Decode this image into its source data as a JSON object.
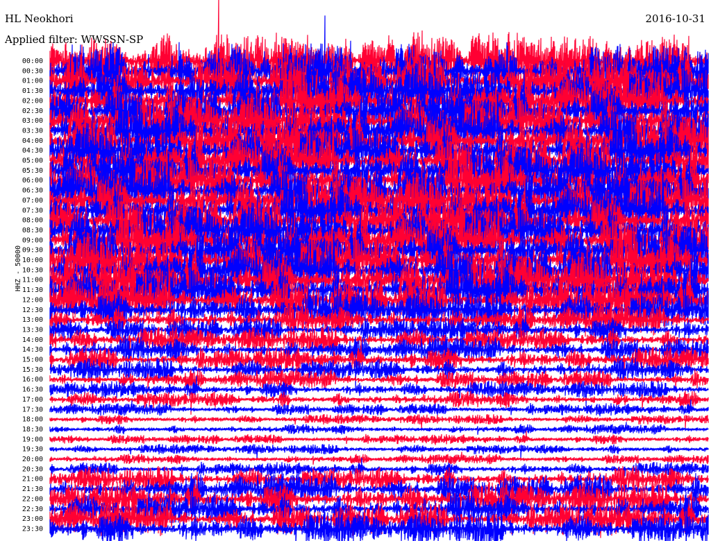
{
  "header": {
    "station": "HL Neokhori",
    "date": "2016-10-31",
    "filter": "Applied filter: WWSSN-SP"
  },
  "chart_data": {
    "type": "line",
    "title": "HL Neokhori",
    "date": "2016-10-31",
    "subtitle": "Applied filter: WWSSN-SP",
    "ylabel": "HHZ - 50000",
    "row_labels": [
      "00:00",
      "00:30",
      "01:00",
      "01:30",
      "02:00",
      "02:30",
      "03:00",
      "03:30",
      "04:00",
      "04:30",
      "05:00",
      "05:30",
      "06:00",
      "06:30",
      "07:00",
      "07:30",
      "08:00",
      "08:30",
      "09:00",
      "09:30",
      "10:00",
      "10:30",
      "11:00",
      "11:30",
      "12:00",
      "12:30",
      "13:00",
      "13:30",
      "14:00",
      "14:30",
      "15:00",
      "15:30",
      "16:00",
      "16:30",
      "17:00",
      "17:30",
      "18:00",
      "18:30",
      "19:00",
      "19:30",
      "20:00",
      "20:30",
      "21:00",
      "21:30",
      "22:00",
      "22:30",
      "23:00",
      "23:30"
    ],
    "row_amplitude": [
      1.0,
      1.0,
      1.0,
      1.0,
      1.0,
      1.0,
      1.0,
      1.0,
      1.0,
      1.0,
      1.0,
      1.0,
      1.0,
      1.0,
      1.0,
      1.0,
      1.0,
      1.0,
      1.0,
      1.0,
      1.0,
      1.0,
      1.0,
      0.95,
      0.85,
      0.7,
      0.55,
      0.45,
      0.45,
      0.45,
      0.45,
      0.4,
      0.35,
      0.3,
      0.3,
      0.22,
      0.18,
      0.18,
      0.18,
      0.18,
      0.18,
      0.25,
      0.45,
      0.55,
      0.6,
      0.6,
      0.6,
      0.6
    ],
    "colors": {
      "odd_rows": "#ff0033",
      "even_rows": "#0000ff"
    },
    "grid": false
  }
}
